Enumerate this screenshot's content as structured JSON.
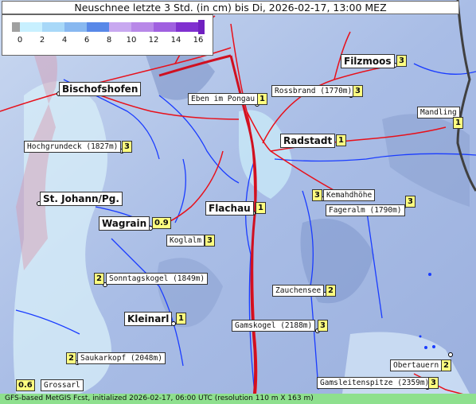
{
  "title": "Neuschnee letzte 3 Std. (in cm) bis Di, 2026-02-17, 13:00 MEZ",
  "legend": {
    "ticks": [
      "0",
      "2",
      "4",
      "6",
      "8",
      "10",
      "12",
      "14",
      "16"
    ],
    "colors": [
      "#a0a0a0",
      "#c8f0ff",
      "#a8d8f8",
      "#88b8f0",
      "#5888e8",
      "#c8a8f0",
      "#b888e8",
      "#a060e0",
      "#8030d0"
    ]
  },
  "locations": [
    {
      "name": "Filzmoos",
      "value": "3",
      "type": "town"
    },
    {
      "name": "Bischofshofen",
      "value": "",
      "type": "town"
    },
    {
      "name": "Eben im Pongau",
      "value": "1",
      "type": "place"
    },
    {
      "name": "Rossbrand (1770m)",
      "value": "3",
      "type": "peak"
    },
    {
      "name": "Mandling",
      "value": "1",
      "type": "place"
    },
    {
      "name": "Radstadt",
      "value": "1",
      "type": "town"
    },
    {
      "name": "Hochgrundeck (1827m)",
      "value": "3",
      "type": "peak"
    },
    {
      "name": "St. Johann/Pg.",
      "value": "",
      "type": "town"
    },
    {
      "name": "Kemahdhöhe",
      "value": "3",
      "type": "peak"
    },
    {
      "name": "Fageralm (1790m)",
      "value": "3",
      "type": "peak"
    },
    {
      "name": "Flachau",
      "value": "1",
      "type": "town"
    },
    {
      "name": "Wagrain",
      "value": "0.9",
      "type": "town"
    },
    {
      "name": "Koglalm",
      "value": "3",
      "type": "peak"
    },
    {
      "name": "Sonntagskogel (1849m)",
      "value": "2",
      "type": "peak"
    },
    {
      "name": "Zauchensee",
      "value": "2",
      "type": "place"
    },
    {
      "name": "Kleinarl",
      "value": "1",
      "type": "town"
    },
    {
      "name": "Gamskogel (2188m)",
      "value": "3",
      "type": "peak"
    },
    {
      "name": "Obertauern",
      "value": "2",
      "type": "place"
    },
    {
      "name": "Saukarkopf (2048m)",
      "value": "2",
      "type": "peak"
    },
    {
      "name": "Grossarl",
      "value": "0.6",
      "type": "place"
    },
    {
      "name": "Gamsleitenspitze (2359m)",
      "value": "3",
      "type": "peak"
    }
  ],
  "footer": "GFS-based MetGIS Fcst, initialized 2026-02-17, 06:00 UTC  (resolution 110 m X 163 m)"
}
